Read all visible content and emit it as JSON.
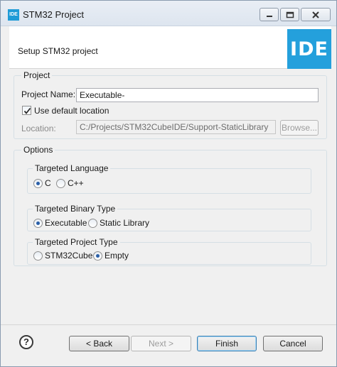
{
  "window": {
    "app_icon_text": "IDE",
    "title": "STM32 Project"
  },
  "banner": {
    "heading": "Setup STM32 project",
    "logo_text": "IDE"
  },
  "project_group": {
    "legend": "Project",
    "name_label": "Project Name:",
    "name_value": "Executable-",
    "use_default_label": "Use default location",
    "use_default_checked": true,
    "location_label": "Location:",
    "location_value": "C:/Projects/STM32CubeIDE/Support-StaticLibrary",
    "browse_label": "Browse..."
  },
  "options_group": {
    "legend": "Options",
    "language": {
      "legend": "Targeted Language",
      "options": [
        "C",
        "C++"
      ],
      "selected": "C"
    },
    "binary": {
      "legend": "Targeted Binary Type",
      "options": [
        "Executable",
        "Static Library"
      ],
      "selected": "Executable"
    },
    "project_type": {
      "legend": "Targeted Project Type",
      "options": [
        "STM32Cube",
        "Empty"
      ],
      "selected": "Empty"
    }
  },
  "footer": {
    "help_glyph": "?",
    "back_label": "< Back",
    "next_label": "Next >",
    "finish_label": "Finish",
    "cancel_label": "Cancel"
  },
  "colors": {
    "accent": "#24a0dc",
    "radio_dot": "#2a5fa8"
  }
}
